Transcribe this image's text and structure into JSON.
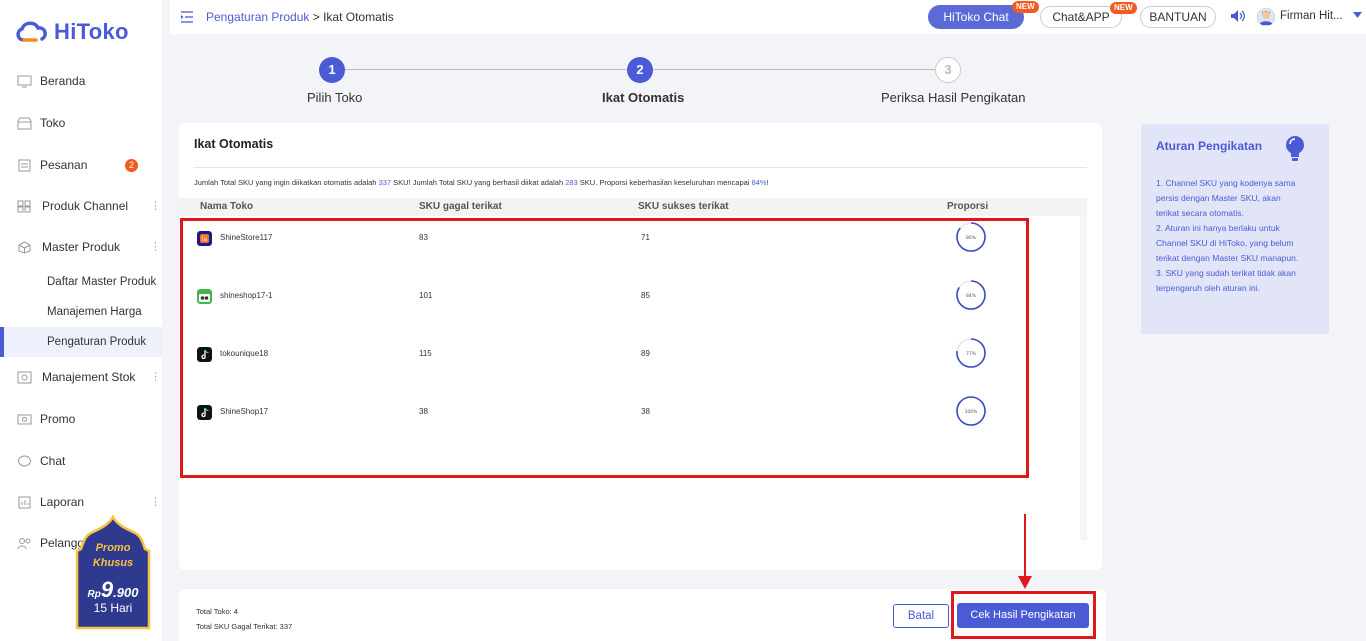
{
  "app": {
    "logo_text": "HiToko"
  },
  "sidebar": {
    "items": [
      {
        "label": "Beranda"
      },
      {
        "label": "Toko"
      },
      {
        "label": "Pesanan",
        "badge": "2"
      },
      {
        "label": "Produk Channel"
      },
      {
        "label": "Master Produk"
      },
      {
        "label": "Manajement Stok"
      },
      {
        "label": "Promo"
      },
      {
        "label": "Chat"
      },
      {
        "label": "Laporan"
      },
      {
        "label": "Pelangga"
      }
    ],
    "sub_items": [
      {
        "label": "Daftar Master Produk"
      },
      {
        "label": "Manajemen Harga"
      },
      {
        "label": "Pengaturan Produk"
      }
    ],
    "promo": {
      "line1": "Promo",
      "line2": "Khusus",
      "currency": "Rp",
      "price_big": "9",
      "price_small": ".900",
      "duration": "15 Hari"
    }
  },
  "header": {
    "breadcrumb_link": "Pengaturan Produk",
    "breadcrumb_rest": " > Ikat Otomatis",
    "hitoko_chat": "HiToko Chat",
    "chat_app": "Chat&APP",
    "new_tag": "NEW",
    "bantuan": "BANTUAN",
    "user_name": "Firman Hit..."
  },
  "steps": [
    {
      "number": "1",
      "label": "Pilih Toko"
    },
    {
      "number": "2",
      "label": "Ikat Otomatis"
    },
    {
      "number": "3",
      "label": "Periksa Hasil Pengikatan"
    }
  ],
  "card": {
    "title": "Ikat Otomatis",
    "summary": {
      "part1": "Jumlah Total SKU yang ingin diikatkan otomatis adalah ",
      "total": "337",
      "part2": " SKU! Jumlah Total SKU yang berhasil diikat adalah ",
      "bound": "283",
      "part3": " SKU. Proporsi keberhasilan keseluruhan mencapai ",
      "ratio": "84%",
      "part4": "!"
    },
    "columns": {
      "name": "Nama Toko",
      "failed": "SKU gagal terikat",
      "success": "SKU sukses terikat",
      "ratio": "Proporsi"
    },
    "rows": [
      {
        "store": "ShineStore117",
        "failed": "83",
        "success": "71",
        "ratio_label": "86%",
        "ratio": 0.86,
        "platform": "lazada"
      },
      {
        "store": "shineshop17-1",
        "failed": "101",
        "success": "85",
        "ratio_label": "84%",
        "ratio": 0.84,
        "platform": "tokopedia"
      },
      {
        "store": "tokounique18",
        "failed": "115",
        "success": "89",
        "ratio_label": "77%",
        "ratio": 0.77,
        "platform": "tiktok"
      },
      {
        "store": "ShineShop17",
        "failed": "38",
        "success": "38",
        "ratio_label": "100%",
        "ratio": 1.0,
        "platform": "tiktok"
      }
    ]
  },
  "rules": {
    "title": "Aturan Pengikatan",
    "lines": [
      "1. Channel SKU yang kodenya sama",
      "persis dengan Master SKU, akan",
      "terikat secara otomatis.",
      "2. Aturan ini hanya berlaku untuk",
      "Channel SKU di HiToko, yang belum",
      "terikat dengan Master SKU manapun.",
      "3. SKU yang sudah terikat tidak akan",
      "terpengaruh oleh aturan ini."
    ]
  },
  "footer": {
    "total_toko": "Total Toko: 4",
    "total_gagal": "Total SKU Gagal Terikat: 337",
    "batal": "Batal",
    "cek": "Cek Hasil Pengikatan"
  },
  "colors": {
    "accent": "#4a5bd5",
    "highlight": "#e0171b",
    "badge": "#f25a1e"
  }
}
